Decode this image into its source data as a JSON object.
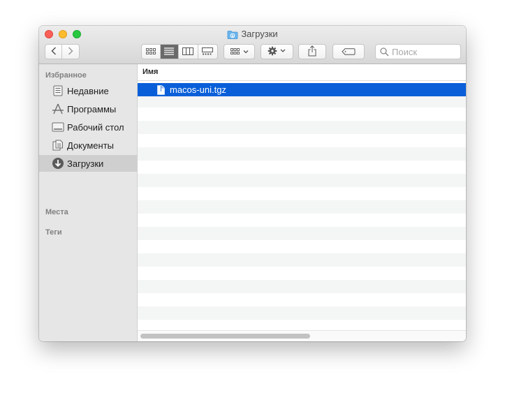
{
  "window": {
    "title": "Загрузки"
  },
  "toolbar": {
    "nav_back": "back",
    "nav_forward": "forward",
    "views": [
      "icon-view",
      "list-view",
      "column-view",
      "gallery-view"
    ],
    "active_view": "list-view",
    "group_button": "group-by",
    "action_button": "action-gear",
    "share_button": "share",
    "tags_button": "edit-tags",
    "search_placeholder": "Поиск"
  },
  "sidebar": {
    "favorites_header": "Избранное",
    "items": [
      {
        "label": "Недавние",
        "icon": "recents-icon"
      },
      {
        "label": "Программы",
        "icon": "applications-icon"
      },
      {
        "label": "Рабочий стол",
        "icon": "desktop-icon"
      },
      {
        "label": "Документы",
        "icon": "documents-icon"
      },
      {
        "label": "Загрузки",
        "icon": "downloads-icon",
        "selected": true
      }
    ],
    "places_header": "Места",
    "tags_header": "Теги"
  },
  "list": {
    "column_name": "Имя",
    "files": [
      {
        "name": "macos-uni.tgz",
        "selected": true
      }
    ]
  },
  "colors": {
    "selection": "#0a5fd9",
    "sidebar_bg": "#e6e6e6",
    "close": "#fc5f57",
    "minimize": "#fdbc2e",
    "zoom": "#28c840"
  }
}
